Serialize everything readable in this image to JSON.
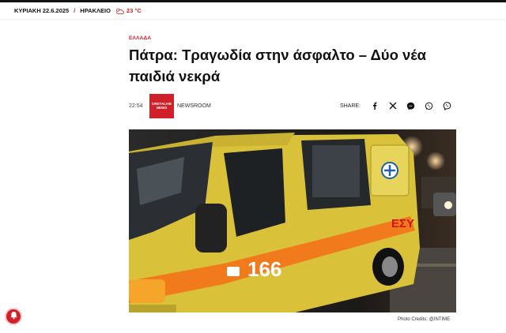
{
  "topbar": {
    "date": "ΚΥΡΙΑΚΗ 22.6.2025",
    "separator": "/",
    "city": "ΗΡΑΚΛΕΙΟ",
    "weather_icon": "cloud-sun-icon",
    "temperature": "23 °C"
  },
  "article": {
    "category": "ΕΛΛΑΔΑ",
    "title": "Πάτρα: Τραγωδία στην άσφαλτο – Δύο νέα παιδιά νεκρά",
    "time": "22:54",
    "logo_line1": "CRETALIVE",
    "logo_line2": "NEWS",
    "author": "NEWSROOM"
  },
  "share": {
    "label": "SHARE:",
    "buttons": [
      "facebook-icon",
      "x-icon",
      "messenger-icon",
      "whatsapp-icon",
      "viber-icon"
    ]
  },
  "photo": {
    "vehicle_text": "ΕΣΥ",
    "phone_number": "166",
    "credit": "Photo Credits: @INTIME"
  },
  "colors": {
    "accent": "#d0202a",
    "ambulance_yellow": "#d9c23a",
    "ambulance_stripe": "#f07a1c"
  }
}
